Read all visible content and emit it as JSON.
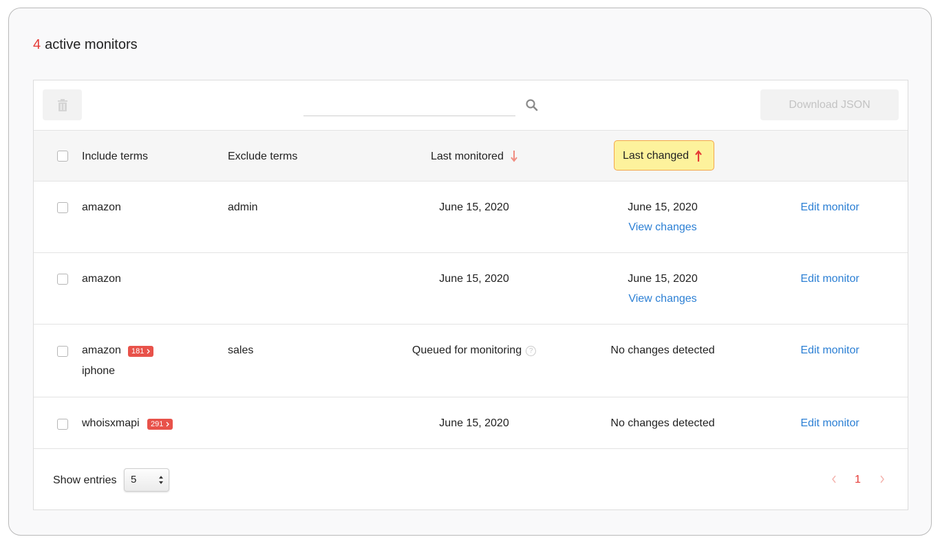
{
  "header": {
    "count": "4",
    "label": "active monitors"
  },
  "toolbar": {
    "search_placeholder": "",
    "download_label": "Download JSON"
  },
  "table": {
    "columns": {
      "include": "Include terms",
      "exclude": "Exclude terms",
      "last_monitored": "Last monitored",
      "last_changed": "Last changed"
    },
    "rows": [
      {
        "include": "amazon",
        "include_extra": "",
        "badge": "",
        "exclude": "admin",
        "last_monitored": "June 15, 2020",
        "last_changed": "June 15, 2020",
        "view_changes": "View changes",
        "edit": "Edit monitor"
      },
      {
        "include": "amazon",
        "include_extra": "",
        "badge": "",
        "exclude": "",
        "last_monitored": "June 15, 2020",
        "last_changed": "June 15, 2020",
        "view_changes": "View changes",
        "edit": "Edit monitor"
      },
      {
        "include": "amazon",
        "include_extra": "iphone",
        "badge": "181",
        "exclude": "sales",
        "last_monitored": "Queued for monitoring",
        "last_changed": "No changes detected",
        "view_changes": "",
        "edit": "Edit monitor"
      },
      {
        "include": "whoisxmapi",
        "include_extra": "",
        "badge": "291",
        "exclude": "",
        "last_monitored": "June 15, 2020",
        "last_changed": "No changes detected",
        "view_changes": "",
        "edit": "Edit monitor"
      }
    ]
  },
  "footer": {
    "show_entries_label": "Show entries",
    "entries_value": "5",
    "current_page": "1"
  },
  "colors": {
    "accent_red": "#e53935",
    "link_blue": "#2b7fd4",
    "badge_red": "#e8524a",
    "highlight_yellow": "#fdf29c",
    "highlight_border": "#f3a64a"
  },
  "icons": [
    "trash-icon",
    "search-icon",
    "sort-down-arrow-icon",
    "sort-up-arrow-icon",
    "question-icon",
    "chevron-right-icon",
    "chevron-left-icon",
    "select-arrows-icon"
  ]
}
